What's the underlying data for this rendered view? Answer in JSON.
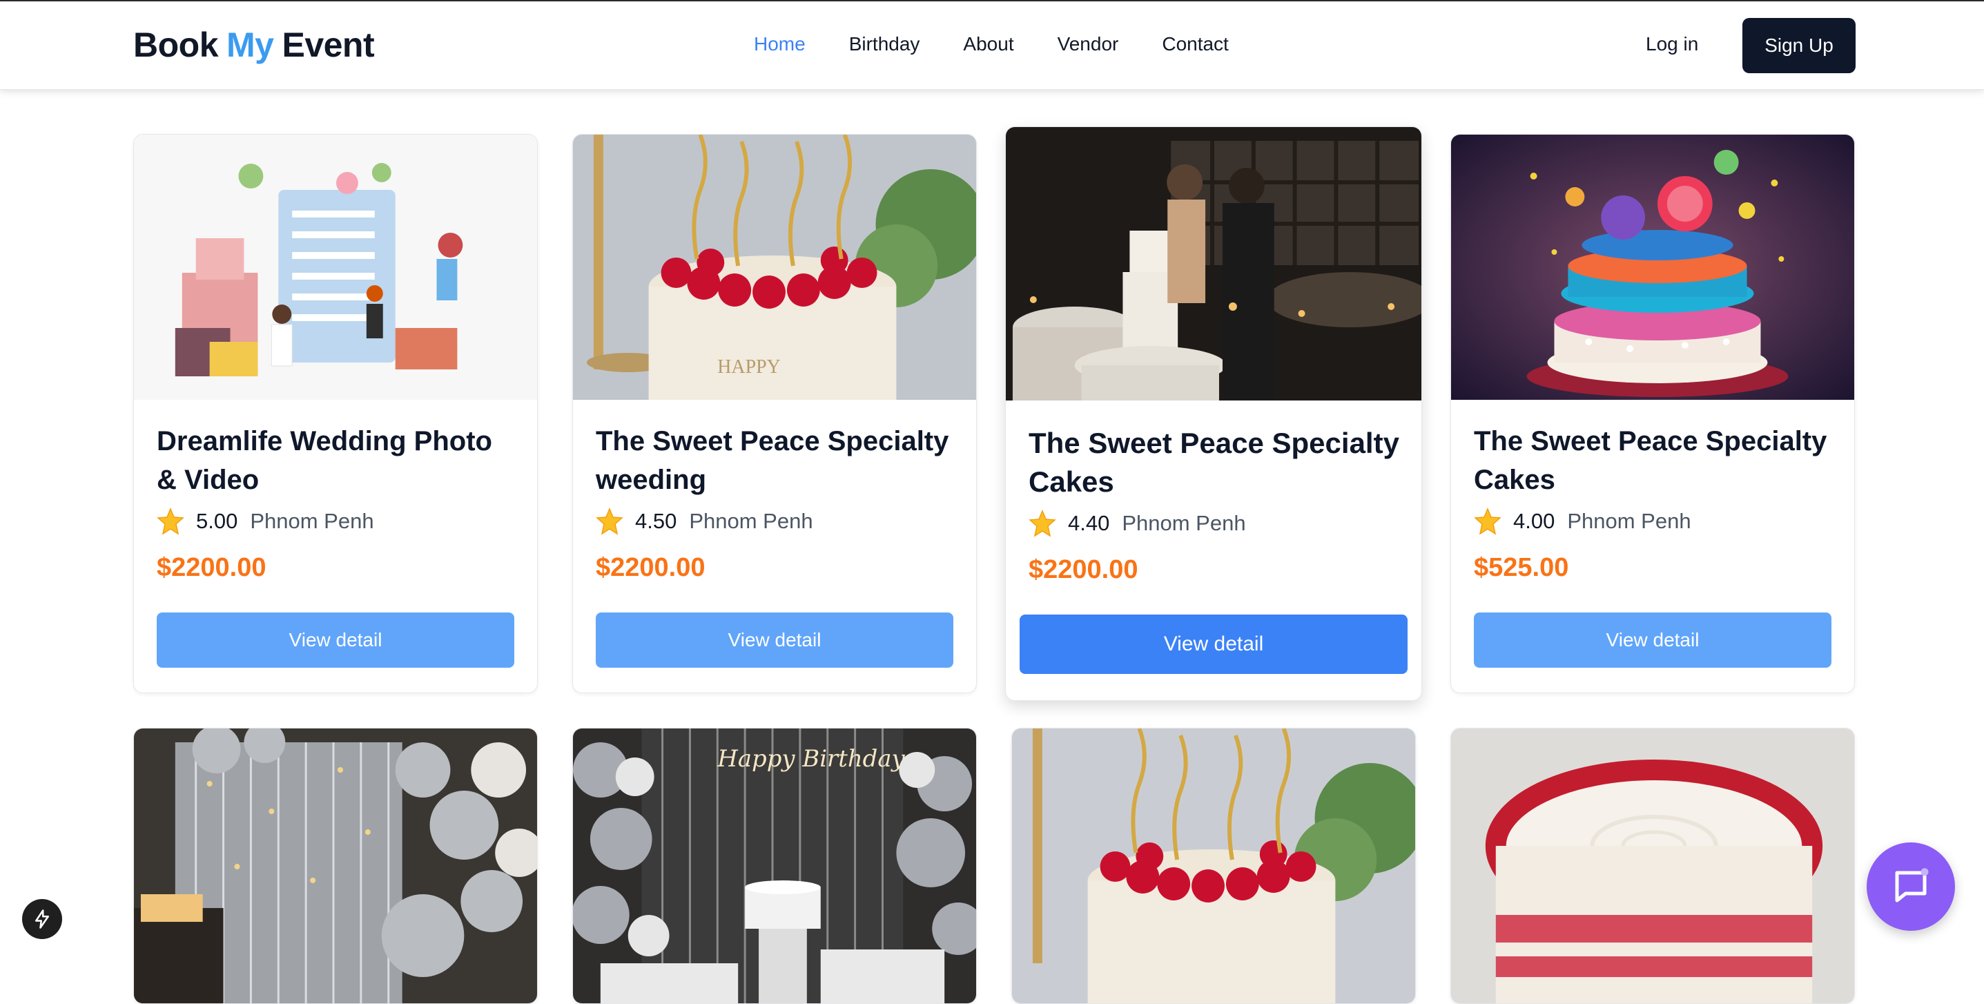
{
  "brand": {
    "part1": "Book",
    "part2": "My",
    "part3": "Event"
  },
  "nav": [
    "Home",
    "Birthday",
    "About",
    "Vendor",
    "Contact"
  ],
  "auth": {
    "login": "Log in",
    "signup": "Sign Up"
  },
  "cards": [
    {
      "title": "Dreamlife Wedding Photo & Video",
      "rating": "5.00",
      "location": "Phnom Penh",
      "price": "$2200.00",
      "button": "View detail",
      "image": "event-planning-illustration"
    },
    {
      "title": "The Sweet Peace Specialty weeding",
      "rating": "4.50",
      "location": "Phnom Penh",
      "price": "$2200.00",
      "button": "View detail",
      "image": "raspberry-birthday-cake"
    },
    {
      "title": "The Sweet Peace Specialty Cakes",
      "rating": "4.40",
      "location": "Phnom Penh",
      "price": "$2200.00",
      "button": "View detail",
      "image": "wedding-couple-cake"
    },
    {
      "title": "The Sweet Peace Specialty Cakes",
      "rating": "4.00",
      "location": "Phnom Penh",
      "price": "$525.00",
      "button": "View detail",
      "image": "colorful-candy-cake"
    }
  ],
  "row2_images": [
    "silver-balloons-decor",
    "happy-birthday-backdrop",
    "raspberry-birthday-cake",
    "red-velvet-cake"
  ],
  "colors": {
    "accent": "#3b82f6",
    "price": "#f97316",
    "button": "#60a5fa",
    "dark": "#0f172a",
    "chat": "#8b5cf6"
  },
  "icons": {
    "rating": "star-icon",
    "chat": "chat-bubble-icon",
    "quick": "lightning-icon"
  }
}
